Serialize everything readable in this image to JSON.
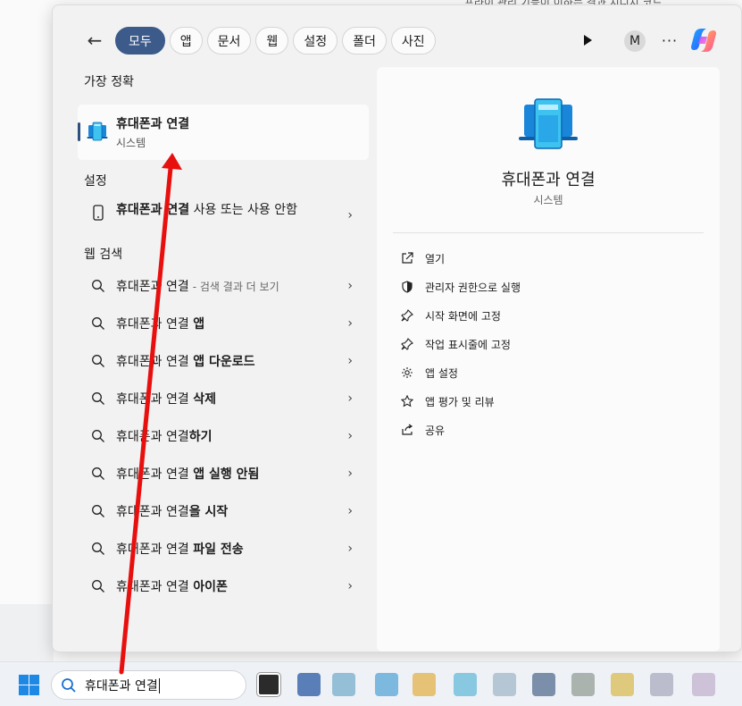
{
  "background": {
    "text": "프라이 관리 기능이 이하는 결과 지니지 코드"
  },
  "topbar": {
    "filters": [
      "모두",
      "앱",
      "문서",
      "웹",
      "설정",
      "폴더",
      "사진"
    ],
    "active_filter": "모두",
    "avatar_letter": "M",
    "more": "···"
  },
  "left": {
    "best_match_title": "가장 정확",
    "best_match": {
      "name": "휴대폰과 연결",
      "sub": "시스템"
    },
    "settings_title": "설정",
    "settings_item": {
      "bold": "휴대폰과 연결",
      "rest": " 사용 또는 사용 안함"
    },
    "web_title": "웹 검색",
    "web_items": [
      {
        "base": "휴대폰과 연결",
        "bold": "",
        "hint": "- 검색 결과 더 보기"
      },
      {
        "base": "휴대폰과 연결 ",
        "bold": "앱",
        "hint": ""
      },
      {
        "base": "휴대폰과 연결 ",
        "bold": "앱 다운로드",
        "hint": ""
      },
      {
        "base": "휴대폰과 연결 ",
        "bold": "삭제",
        "hint": ""
      },
      {
        "base": "휴대폰과 연결",
        "bold": "하기",
        "hint": ""
      },
      {
        "base": "휴대폰과 연결 ",
        "bold": "앱 실행 안됨",
        "hint": ""
      },
      {
        "base": "휴대폰과 연결",
        "bold": "을 시작",
        "hint": ""
      },
      {
        "base": "휴대폰과 연결 ",
        "bold": "파일 전송",
        "hint": ""
      },
      {
        "base": "휴대폰과 연결 ",
        "bold": "아이폰",
        "hint": ""
      }
    ]
  },
  "right": {
    "name": "휴대폰과 연결",
    "sub": "시스템",
    "actions": [
      {
        "label": "열기",
        "icon": "open-external-icon"
      },
      {
        "label": "관리자 권한으로 실행",
        "icon": "shield-icon"
      },
      {
        "label": "시작 화면에 고정",
        "icon": "pin-icon"
      },
      {
        "label": "작업 표시줄에 고정",
        "icon": "pin-icon"
      },
      {
        "label": "앱 설정",
        "icon": "gear-icon"
      },
      {
        "label": "앱 평가 및 리뷰",
        "icon": "star-icon"
      },
      {
        "label": "공유",
        "icon": "share-icon"
      }
    ]
  },
  "taskbar": {
    "search_value": "휴대폰과 연결"
  },
  "colors": {
    "accent": "#3c5a8a",
    "annotation_arrow": "#e8100f"
  }
}
